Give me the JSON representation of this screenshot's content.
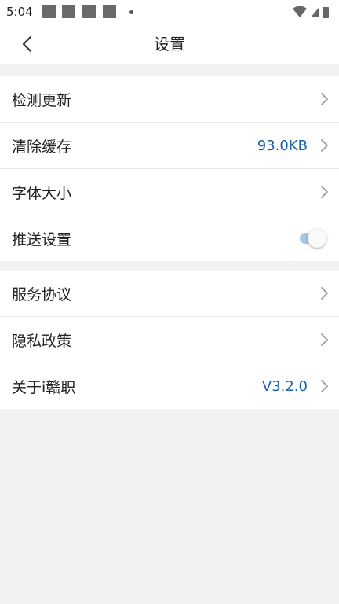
{
  "status_bar": {
    "time": "5:04"
  },
  "header": {
    "title": "设置",
    "back_icon": "chevron-left-icon"
  },
  "groups": [
    {
      "items": [
        {
          "label": "检测更新",
          "value": "",
          "control": "chevron"
        },
        {
          "label": "清除缓存",
          "value": "93.0KB",
          "control": "chevron"
        },
        {
          "label": "字体大小",
          "value": "",
          "control": "chevron"
        },
        {
          "label": "推送设置",
          "value": "",
          "control": "toggle",
          "toggle_on": true
        }
      ]
    },
    {
      "items": [
        {
          "label": "服务协议",
          "value": "",
          "control": "chevron"
        },
        {
          "label": "隐私政策",
          "value": "",
          "control": "chevron"
        },
        {
          "label": "关于i赣职",
          "value": "V3.2.0",
          "control": "chevron"
        }
      ]
    }
  ],
  "colors": {
    "accent": "#1a5fa8",
    "background": "#f2f2f2",
    "toggle_track": "#a9c6e6"
  }
}
